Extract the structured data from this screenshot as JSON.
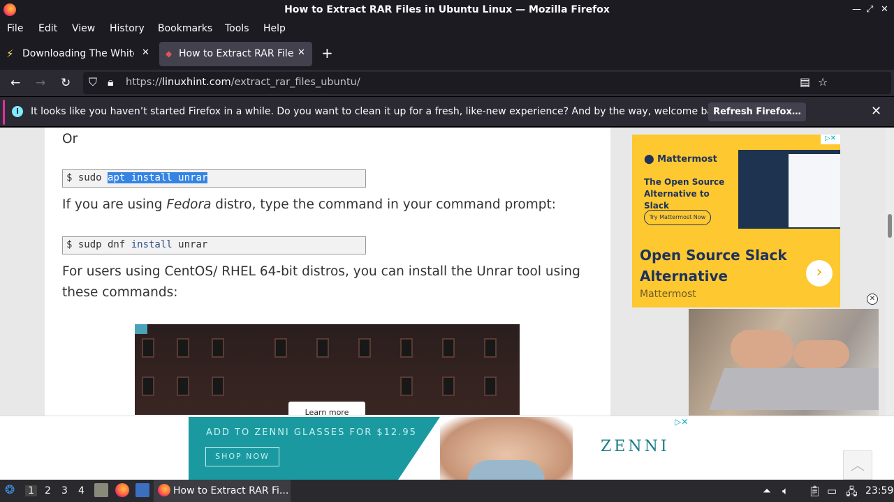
{
  "window": {
    "title": "How to Extract RAR Files in Ubuntu Linux — Mozilla Firefox"
  },
  "menu": [
    "File",
    "Edit",
    "View",
    "History",
    "Bookmarks",
    "Tools",
    "Help"
  ],
  "tabs": [
    {
      "label": "Downloading The White I",
      "icon": "lightning-icon",
      "active": false
    },
    {
      "label": "How to Extract RAR Files",
      "icon": "site-icon",
      "active": true
    }
  ],
  "url": {
    "scheme": "https://",
    "domain": "linuxhint.com",
    "path": "/extract_rar_files_ubuntu/"
  },
  "notification": {
    "message": "It looks like you haven’t started Firefox in a while. Do you want to clean it up for a fresh, like-new experience? And by the way, welcome back!",
    "button": "Refresh Firefox…"
  },
  "article": {
    "or_text": "Or",
    "cmd1": {
      "prefix": "$ sudo ",
      "selected": "apt install unrar"
    },
    "fedora_pre": "If you are using ",
    "fedora_em": "Fedora",
    "fedora_post": " distro, type the command in your command prompt:",
    "cmd2": {
      "prefix": "$ sudp dnf ",
      "kw": "install",
      "suffix": " unrar"
    },
    "centos_line1": "For users using CentOS/ RHEL 64-bit distros, you can install the Unrar tool using",
    "centos_line2": "these commands:",
    "photo_button": "Learn more"
  },
  "sidebar_ad": {
    "logo": "Mattermost",
    "headline": "The Open Source Alternative to Slack",
    "try_button": "Try Mattermost Now",
    "big_title": "Open Source Slack Alternative",
    "brand": "Mattermost",
    "ad_choices": "▷✕"
  },
  "bottom_ad": {
    "text": "ADD TO ZENNI GLASSES FOR $12.95",
    "shop_button": "SHOP NOW",
    "brand": "ZENNI",
    "ad_choices": "▷✕"
  },
  "taskbar": {
    "workspaces": [
      "1",
      "2",
      "3",
      "4"
    ],
    "active_task": "How to Extract RAR Fi...",
    "clock": "23:59"
  }
}
